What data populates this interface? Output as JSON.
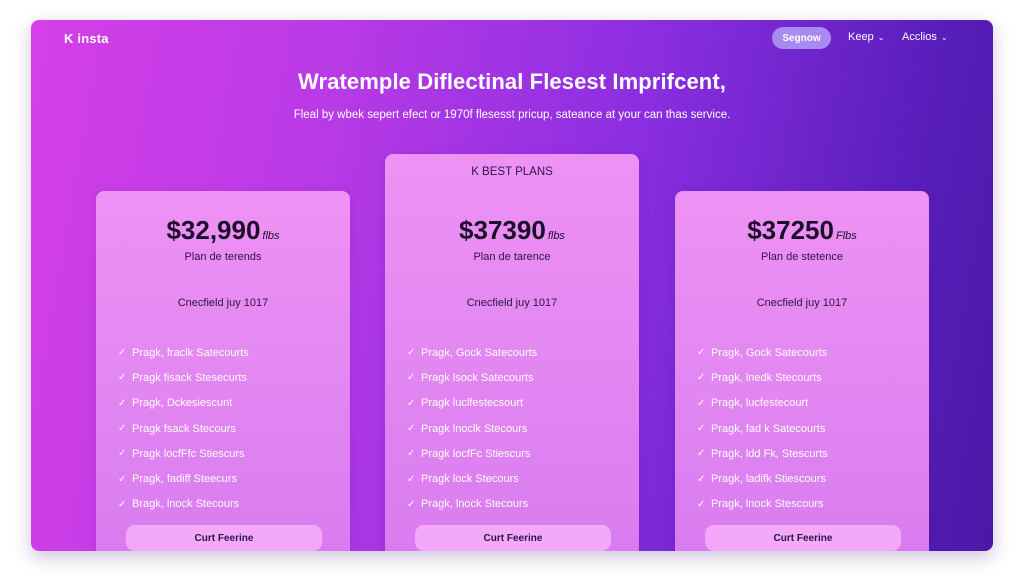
{
  "header": {
    "logo": "K insta",
    "cta_label": "Segnow",
    "nav": [
      {
        "label": "Keep"
      },
      {
        "label": "Acclios"
      }
    ]
  },
  "hero": {
    "headline": "Wratemple Diflectinal Flesest Imprifcent,",
    "subline": "Fleal by wbek sepert efect or 1970f flesesst pricup, sateance at your can thas service."
  },
  "plans": [
    {
      "badge": "",
      "price": "$32,990",
      "per": "flbs",
      "subtitle": "Plan de terends",
      "cycle": "Cnecfield juy 1017",
      "features": [
        "Pragk, fraclk Satecourts",
        "Pragk fisack Stesecurts",
        "Pragk, Dckesiescunt",
        "Pragk fsack Stecours",
        "Pragk locfFfc Stiescurs",
        "Pragk, fadiff Steecurs",
        "Bragk, lnock Stecours"
      ],
      "cta": "Curt Feerine"
    },
    {
      "badge": "K BEST PLANS",
      "price": "$37390",
      "per": "flbs",
      "subtitle": "Plan de tarence",
      "cycle": "Cnecfield juy 1017",
      "features": [
        "Pragk, Gock Satecourts",
        "Pragk lsock Satecourts",
        "Pragk luclfestecsourt",
        "Pragk lnoclk Stecours",
        "Pragk locfFc Stiescurs",
        "Pragk lock Stecours",
        "Pragk, lnock Stecours"
      ],
      "cta": "Curt Feerine"
    },
    {
      "badge": "",
      "price": "$37250",
      "per": "Flbs",
      "subtitle": "Plan de stetence",
      "cycle": "Cnecfield juy 1017",
      "features": [
        "Pragk, Gock Satecourts",
        "Pragk, lnedk Stecourts",
        "Pragk, lucfestecourt",
        "Pragk, fad k Satecourts",
        "Pragk, ldd Fk, Stescurts",
        "Pragk, ladifk Stiescours",
        "Pragk, lnock Stescours"
      ],
      "cta": "Curt Feerine"
    }
  ],
  "colors": {
    "gradient_start": "#d53fe8",
    "gradient_end": "#4a18a6",
    "card": "#e98cf4",
    "cta_button": "#f3a8fa",
    "nav_button": "#a98af0"
  },
  "icons": {
    "check": "check-icon",
    "chevron": "chevron-down-icon"
  }
}
